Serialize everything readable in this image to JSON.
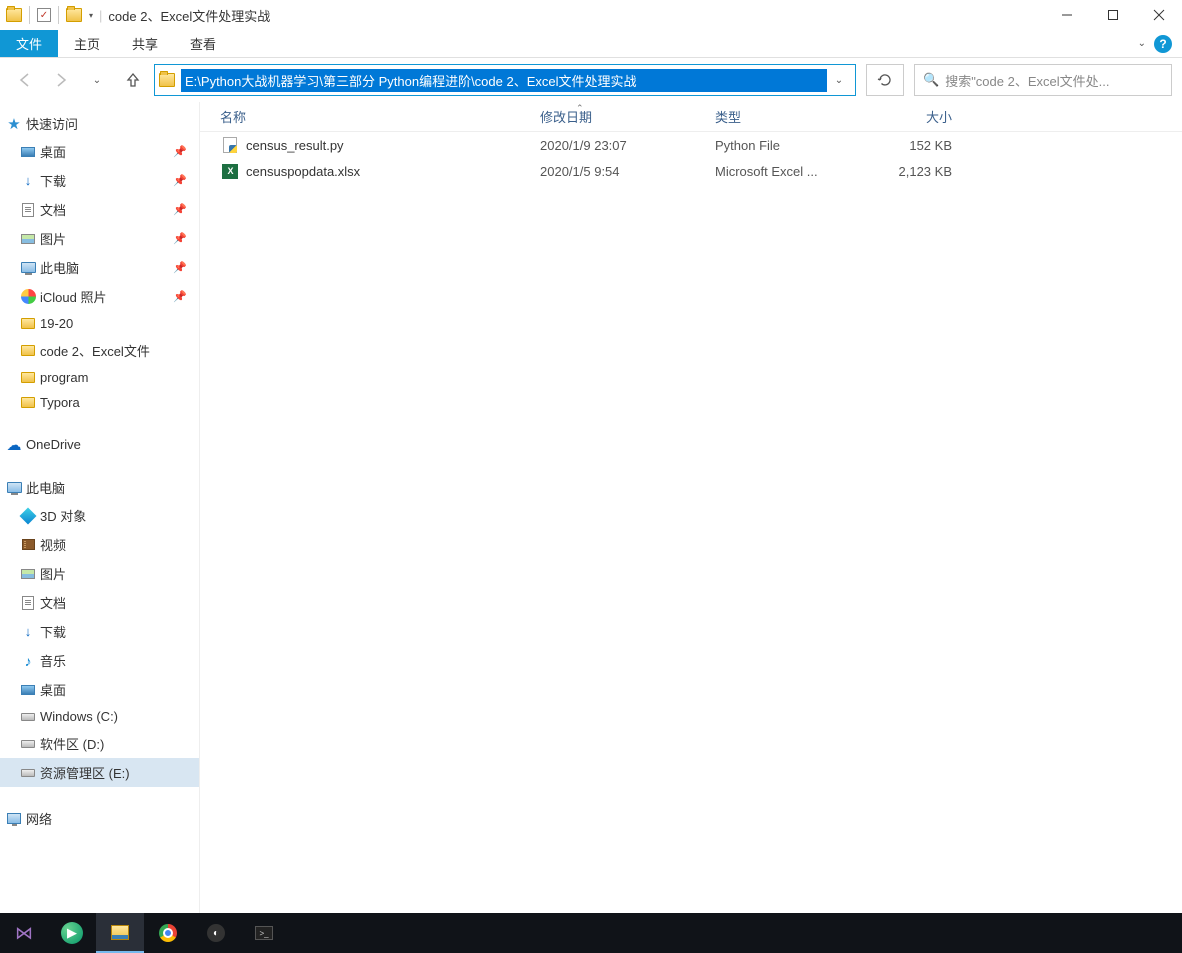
{
  "titlebar": {
    "title": "code 2、Excel文件处理实战"
  },
  "ribbon": {
    "tabs": [
      "文件",
      "主页",
      "共享",
      "查看"
    ]
  },
  "address": {
    "path": "E:\\Python大战机器学习\\第三部分 Python编程进阶\\code 2、Excel文件处理实战"
  },
  "search": {
    "placeholder": "搜索\"code 2、Excel文件处..."
  },
  "sidebar": {
    "quick": {
      "label": "快速访问",
      "items": [
        {
          "label": "桌面",
          "icon": "desk",
          "pinned": true
        },
        {
          "label": "下载",
          "icon": "dl",
          "pinned": true
        },
        {
          "label": "文档",
          "icon": "doc",
          "pinned": true
        },
        {
          "label": "图片",
          "icon": "pic",
          "pinned": true
        },
        {
          "label": "此电脑",
          "icon": "pc",
          "pinned": true
        },
        {
          "label": "iCloud 照片",
          "icon": "icloud",
          "pinned": true
        },
        {
          "label": "19-20",
          "icon": "fold",
          "pinned": false
        },
        {
          "label": "code 2、Excel文件",
          "icon": "fold",
          "pinned": false
        },
        {
          "label": "program",
          "icon": "fold",
          "pinned": false
        },
        {
          "label": "Typora",
          "icon": "fold",
          "pinned": false
        }
      ]
    },
    "onedrive": {
      "label": "OneDrive"
    },
    "thispc": {
      "label": "此电脑",
      "items": [
        {
          "label": "3D 对象",
          "icon": "threed"
        },
        {
          "label": "视频",
          "icon": "vid"
        },
        {
          "label": "图片",
          "icon": "pic"
        },
        {
          "label": "文档",
          "icon": "doc"
        },
        {
          "label": "下载",
          "icon": "dl"
        },
        {
          "label": "音乐",
          "icon": "mus"
        },
        {
          "label": "桌面",
          "icon": "desk"
        },
        {
          "label": "Windows (C:)",
          "icon": "drive"
        },
        {
          "label": "软件区 (D:)",
          "icon": "drive"
        },
        {
          "label": "资源管理区 (E:)",
          "icon": "drive",
          "active": true
        }
      ]
    },
    "network": {
      "label": "网络"
    }
  },
  "columns": {
    "name": "名称",
    "date": "修改日期",
    "type": "类型",
    "size": "大小"
  },
  "files": [
    {
      "name": "census_result.py",
      "date": "2020/1/9 23:07",
      "type": "Python File",
      "size": "152 KB",
      "icon": "py"
    },
    {
      "name": "censuspopdata.xlsx",
      "date": "2020/1/5 9:54",
      "type": "Microsoft Excel ...",
      "size": "2,123 KB",
      "icon": "xl"
    }
  ]
}
